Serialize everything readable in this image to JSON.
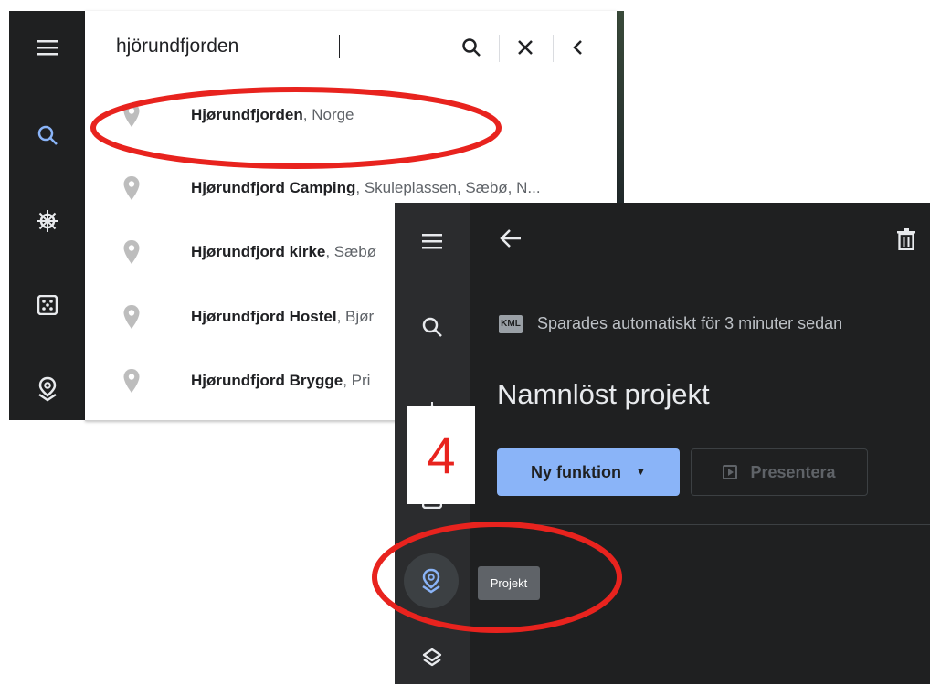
{
  "panel_search": {
    "query": "hjörundfjorden",
    "results": [
      {
        "name": "Hjørundfjorden",
        "detail": ", Norge"
      },
      {
        "name": "Hjørundfjord Camping",
        "detail": ", Skuleplassen, Sæbø, N..."
      },
      {
        "name": "Hjørundfjord kirke",
        "detail": ", Sæbø"
      },
      {
        "name": "Hjørundfjord Hostel",
        "detail": ", Bjør"
      },
      {
        "name": "Hjørundfjord Brygge",
        "detail": ", Pri"
      }
    ],
    "icons": {
      "menu": "menu-icon",
      "search": "search-icon",
      "voyager": "ship-wheel-icon",
      "random": "dice-icon",
      "projects": "projects-pin-icon",
      "clear": "close-icon",
      "collapse": "chevron-left-icon"
    },
    "colors": {
      "rail": "#1f2021",
      "accent": "#8ab4f8",
      "pin": "#bdbdbd"
    }
  },
  "panel_project": {
    "saved_badge": "KML",
    "saved_text": "Sparades automatiskt för 3 minuter sedan",
    "title": "Namnlöst projekt",
    "new_feature_button": "Ny funktion",
    "present_button": "Presentera",
    "tooltip": "Projekt",
    "colors": {
      "background": "#1f2021",
      "rail": "#2b2c2e",
      "primary": "#8ab4f8"
    }
  },
  "annotation": {
    "step_number": "4",
    "highlight_color": "#e8231e"
  }
}
